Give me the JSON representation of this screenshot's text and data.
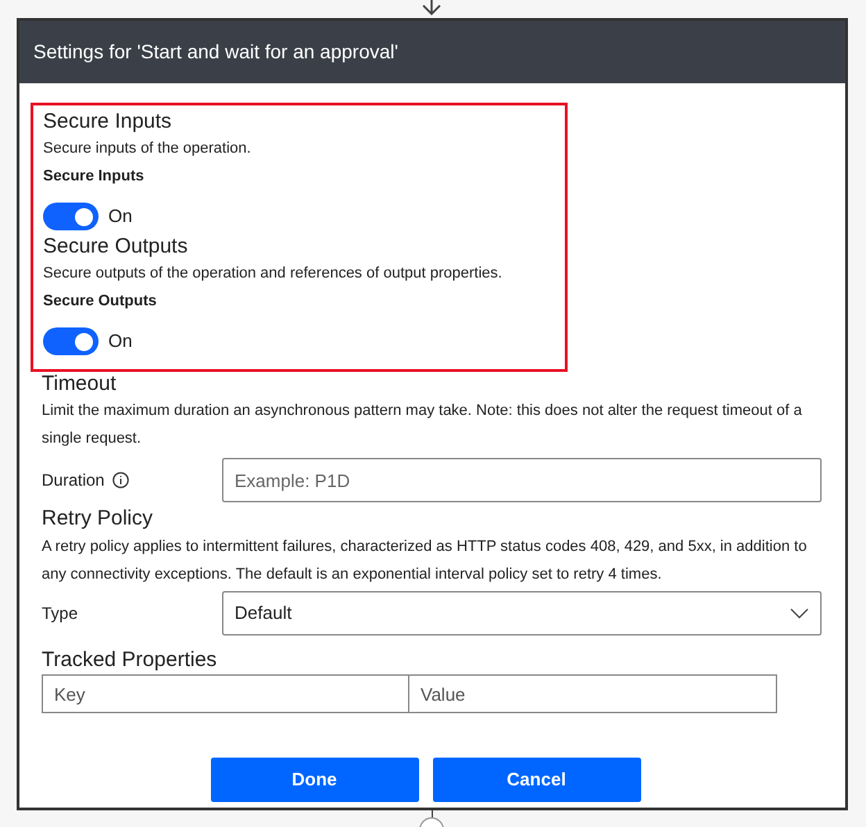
{
  "dialog": {
    "title": "Settings for 'Start and wait for an approval'"
  },
  "secure_sections": [
    {
      "heading": "Secure Inputs",
      "description": "Secure inputs of the operation.",
      "label": "Secure Inputs",
      "toggle": {
        "on": true,
        "label": "On"
      }
    },
    {
      "heading": "Secure Outputs",
      "description": "Secure outputs of the operation and references of output properties.",
      "label": "Secure Outputs",
      "toggle": {
        "on": true,
        "label": "On"
      }
    }
  ],
  "timeout": {
    "heading": "Timeout",
    "description": "Limit the maximum duration an asynchronous pattern may take. Note: this does not alter the request timeout of a single request.",
    "duration": {
      "label": "Duration",
      "placeholder": "Example: P1D"
    }
  },
  "retry_policy": {
    "heading": "Retry Policy",
    "description": "A retry policy applies to intermittent failures, characterized as HTTP status codes 408, 429, and 5xx, in addition to any connectivity exceptions. The default is an exponential interval policy set to retry 4 times.",
    "type": {
      "label": "Type",
      "value": "Default"
    }
  },
  "tracked_properties": {
    "heading": "Tracked Properties",
    "key_placeholder": "Key",
    "value_placeholder": "Value"
  },
  "buttons": [
    "Done",
    "Cancel"
  ]
}
